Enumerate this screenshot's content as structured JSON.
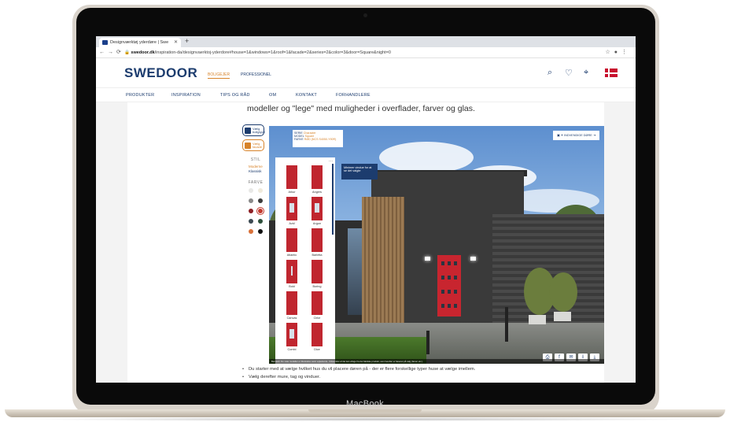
{
  "device_label": "MacBook",
  "browser": {
    "tab_title": "Designværktøj yderdøre | Swe",
    "new_tab": "+",
    "url_domain": "swedoor.dk",
    "url_path": "/inspiration-da/designvaerktoj-yderdore#house=1&windows=1&roof=1&facade=2&series=2&color=3&door=Square&night=0"
  },
  "site": {
    "logo": "SWEDOOR",
    "segments": [
      "BOLIGEJER",
      "PROFESSIONEL"
    ],
    "menu": [
      "PRODUKTER",
      "INSPIRATION",
      "TIPS OG RÅD",
      "OM",
      "KONTAKT",
      "FORHANDLERE"
    ],
    "accent_color": "#d7832a",
    "brand_color": "#1c3c6e"
  },
  "intro_text": "modeller og \"lege\" med muligheder i overflader, farver og glas.",
  "tool": {
    "side_buttons": [
      "Vælg boligtype",
      "Vælg facade"
    ],
    "style_heading": "STIL",
    "style_options": [
      "Moderne",
      "Klassisk"
    ],
    "color_heading": "FARVE",
    "info": {
      "serie_label": "SERIE",
      "serie_value": "Character",
      "model_label": "MODEL",
      "model_value": "Square",
      "farve_label": "FARVE",
      "farve_value": "RØD (NCS S4050-Y90R)"
    },
    "scene_toggle": "INDVENDIGE DØRE",
    "tip": "Minimer vindue for at se det valgte",
    "caption": "Bemærk: De viste modeller er illustrative samt vejledende. Udseendet af det kan afvige fra det faktiske produkt, som herefter er baseret på valg (farver etc.)",
    "doors": [
      "Arkur",
      "Angers",
      "Avid",
      "Argun",
      "Atlantic",
      "Barletta",
      "Bold",
      "Boring",
      "Canvas",
      "Cirke",
      "Combi",
      "Dice"
    ]
  },
  "bullets": [
    "Du starter med at vælge hvilket hus du vil placere døren på - der er flere forskellige typer huse at vælge imellem.",
    "Vælg derefter mure, tag og vinduer."
  ]
}
